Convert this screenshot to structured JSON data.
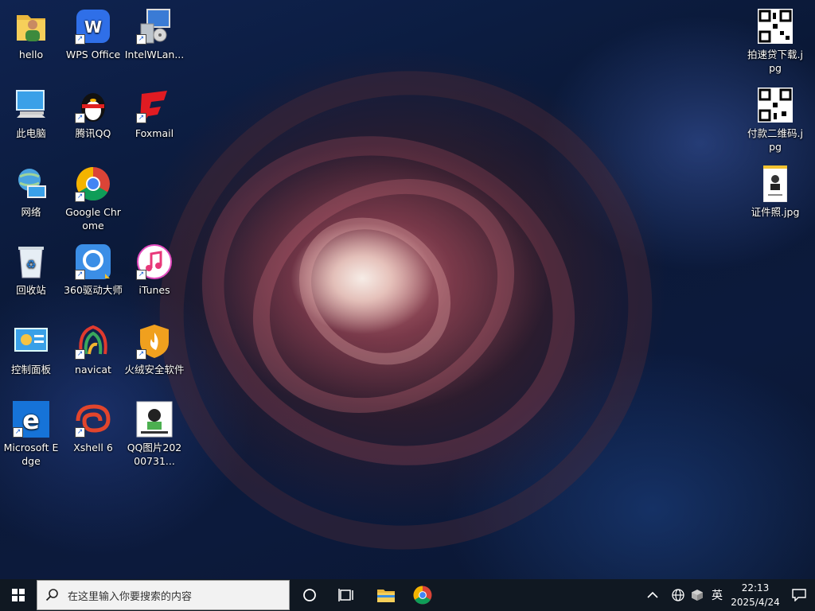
{
  "desktop": {
    "icons_left": [
      {
        "label": "hello",
        "icon": "user-folder-icon"
      },
      {
        "label": "WPS Office",
        "icon": "wps-icon"
      },
      {
        "label": "IntelWLan...",
        "icon": "installer-icon"
      },
      {
        "label": "此电脑",
        "icon": "computer-icon"
      },
      {
        "label": "腾讯QQ",
        "icon": "qq-penguin-icon"
      },
      {
        "label": "Foxmail",
        "icon": "foxmail-icon"
      },
      {
        "label": "网络",
        "icon": "network-icon"
      },
      {
        "label": "Google Chrome",
        "icon": "chrome-icon"
      },
      {
        "label": "回收站",
        "icon": "recycle-bin-icon"
      },
      {
        "label": "360驱动大师",
        "icon": "driver-master-icon"
      },
      {
        "label": "iTunes",
        "icon": "itunes-icon"
      },
      {
        "label": "控制面板",
        "icon": "control-panel-icon"
      },
      {
        "label": "navicat",
        "icon": "navicat-icon"
      },
      {
        "label": "火绒安全软件",
        "icon": "huorong-icon"
      },
      {
        "label": "Microsoft Edge",
        "icon": "edge-icon"
      },
      {
        "label": "Xshell 6",
        "icon": "xshell-icon"
      },
      {
        "label": "QQ图片20200731...",
        "icon": "image-thumbnail-icon"
      }
    ],
    "icons_right": [
      {
        "label": "拍速贷下载.jpg",
        "icon": "qr-code-icon"
      },
      {
        "label": "付款二维码.jpg",
        "icon": "qr-code-icon"
      },
      {
        "label": "证件照.jpg",
        "icon": "id-photo-icon"
      }
    ]
  },
  "taskbar": {
    "search_placeholder": "在这里输入你要搜索的内容",
    "ime": "英",
    "time": "22:13",
    "date": "2025/4/24"
  },
  "colors": {
    "taskbar": "#101822",
    "search_bg": "#f2f2f2",
    "accent": "#1a73e8"
  }
}
